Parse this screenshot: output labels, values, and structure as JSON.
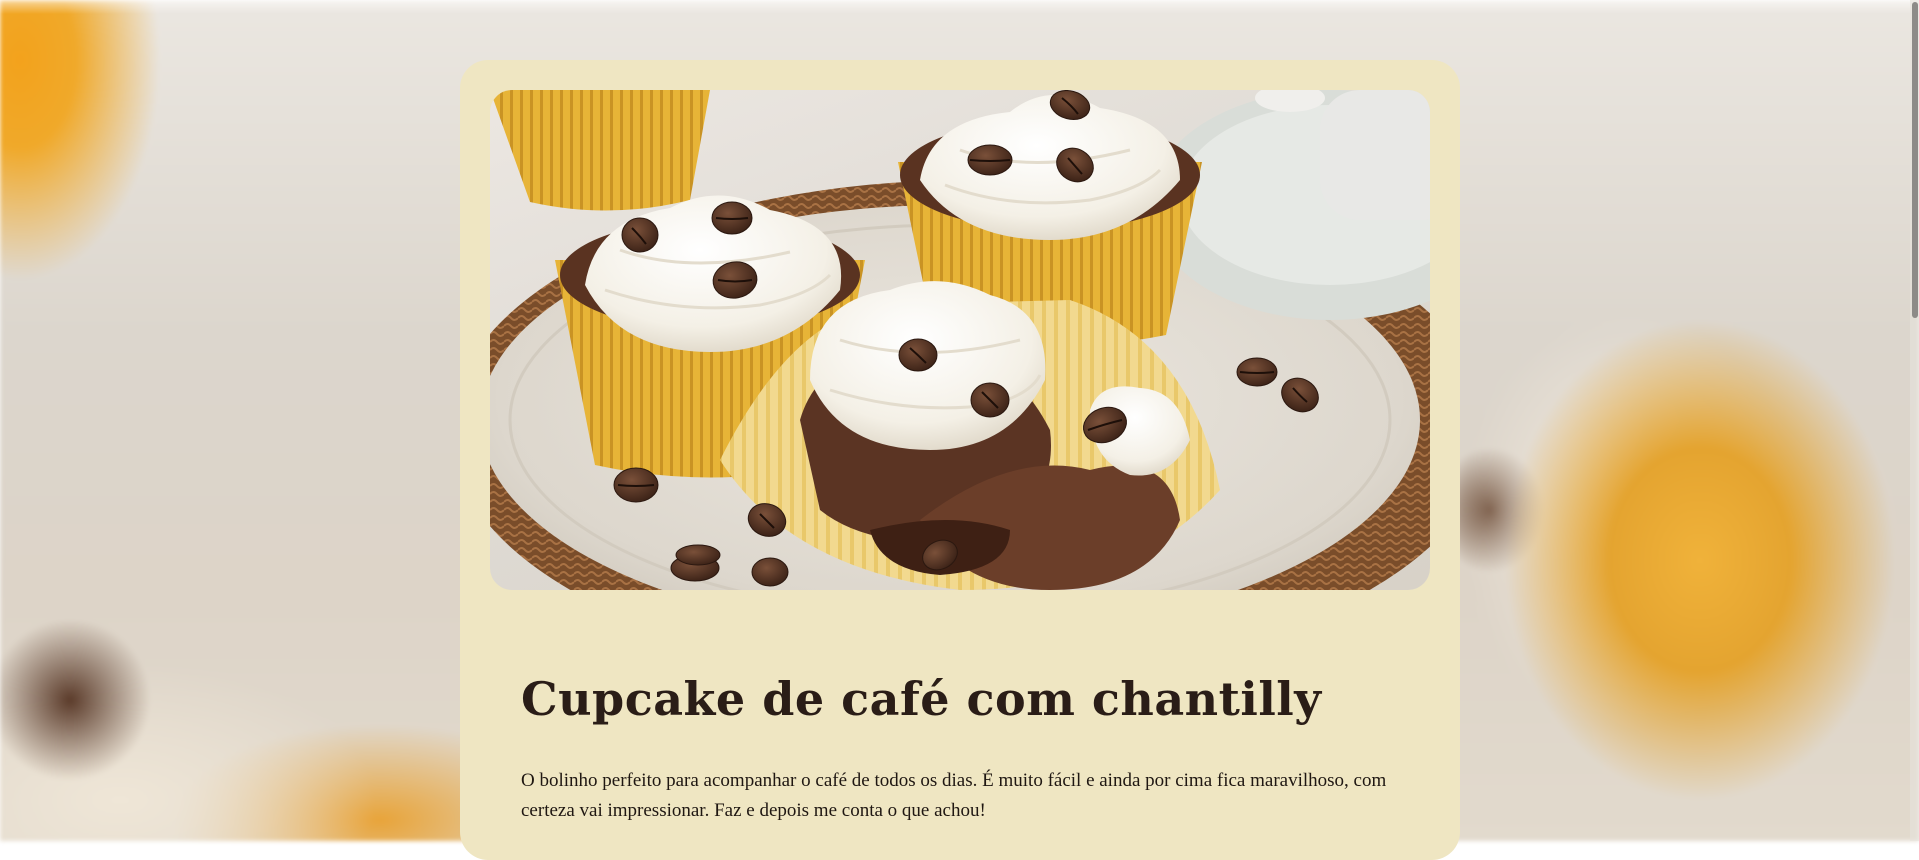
{
  "recipe": {
    "title": "Cupcake de café com chantilly",
    "description": "O bolinho perfeito para acompanhar o café de todos os dias. É muito fácil e ainda por cima fica maravilhoso, com certeza vai impressionar. Faz e depois me conta o que achou!"
  },
  "colors": {
    "card_background": "#efe6c2",
    "title_text": "#2a1d17",
    "body_text": "#1f1712",
    "cupcake_liner": "#e7b437",
    "frosting": "#f8f5ee",
    "coffee_bean": "#4a2c1e"
  },
  "icons": {
    "hero_image": "cupcake-photo"
  }
}
